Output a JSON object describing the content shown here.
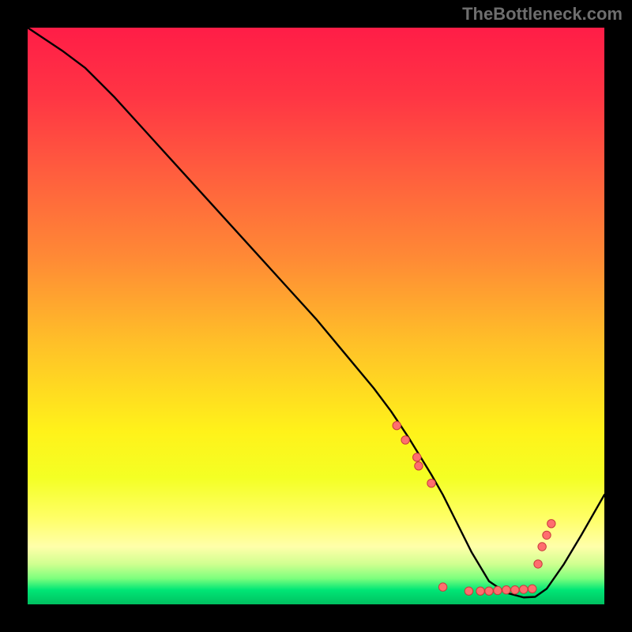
{
  "attribution": "TheBottleneck.com",
  "chart_data": {
    "type": "line",
    "title": "",
    "xlabel": "",
    "ylabel": "",
    "xlim": [
      0,
      100
    ],
    "ylim": [
      0,
      100
    ],
    "grid": false,
    "background_gradient_stops": [
      {
        "offset": 0.0,
        "color": "#ff1d47"
      },
      {
        "offset": 0.12,
        "color": "#ff3544"
      },
      {
        "offset": 0.25,
        "color": "#ff5d3e"
      },
      {
        "offset": 0.4,
        "color": "#ff8a35"
      },
      {
        "offset": 0.55,
        "color": "#ffc128"
      },
      {
        "offset": 0.7,
        "color": "#fff21a"
      },
      {
        "offset": 0.78,
        "color": "#f4ff24"
      },
      {
        "offset": 0.85,
        "color": "#ffff66"
      },
      {
        "offset": 0.9,
        "color": "#ffffaa"
      },
      {
        "offset": 0.93,
        "color": "#d0ff90"
      },
      {
        "offset": 0.955,
        "color": "#7dff7d"
      },
      {
        "offset": 0.975,
        "color": "#00e676"
      },
      {
        "offset": 1.0,
        "color": "#00c060"
      }
    ],
    "curve": {
      "x": [
        0,
        3,
        6,
        10,
        15,
        20,
        25,
        30,
        35,
        40,
        45,
        50,
        55,
        60,
        63,
        66,
        70,
        72,
        74,
        77,
        80,
        83,
        86,
        88,
        90,
        93,
        96,
        100
      ],
      "y": [
        100,
        98,
        96,
        93,
        88,
        82.5,
        77,
        71.5,
        66,
        60.5,
        55,
        49.5,
        43.5,
        37.5,
        33.5,
        29,
        22.5,
        19,
        15,
        9,
        4,
        2,
        1.2,
        1.3,
        2.7,
        7,
        12,
        19
      ],
      "stroke": "#000000",
      "stroke_width": 2.4
    },
    "markers": {
      "x": [
        64.0,
        65.5,
        67.5,
        67.8,
        70.0,
        72.0,
        76.5,
        78.5,
        80.0,
        81.5,
        83.0,
        84.5,
        86.0,
        87.5,
        88.5,
        89.2,
        90.0,
        90.8
      ],
      "y": [
        31.0,
        28.5,
        25.5,
        24.0,
        21.0,
        3.0,
        2.3,
        2.3,
        2.3,
        2.4,
        2.5,
        2.5,
        2.6,
        2.7,
        7.0,
        10.0,
        12.0,
        14.0
      ],
      "fill": "#ff6e6e",
      "stroke": "#c93c3c",
      "radius": 5.2
    }
  }
}
